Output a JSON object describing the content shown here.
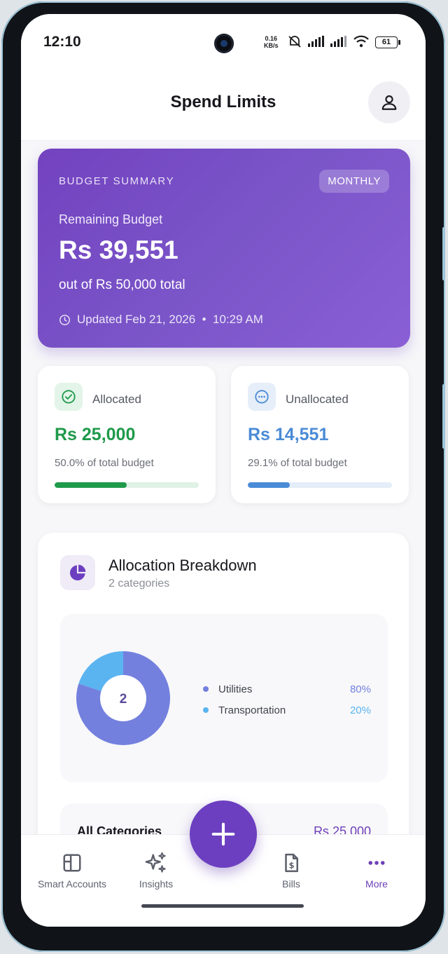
{
  "status_bar": {
    "time": "12:10",
    "network_speed": "0.16",
    "network_unit": "KB/s",
    "battery": "61"
  },
  "header": {
    "title": "Spend Limits",
    "profile_icon": "person-icon"
  },
  "budget_summary": {
    "label": "BUDGET SUMMARY",
    "period_badge": "MONTHLY",
    "remaining_label": "Remaining Budget",
    "remaining_amount": "Rs 39,551",
    "total_text": "out of Rs 50,000 total",
    "updated_text": "Updated Feb 21, 2026  •  10:29 AM",
    "gradient_start": "#7342c0",
    "gradient_end": "#8a5fd6"
  },
  "allocated": {
    "label": "Allocated",
    "amount": "Rs 25,000",
    "percent_text": "50.0% of total budget",
    "progress": 0.5,
    "color": "#1e9a4a",
    "track_color": "#e0f1e6",
    "icon": "check-circle-icon"
  },
  "unallocated": {
    "label": "Unallocated",
    "amount": "Rs 14,551",
    "percent_text": "29.1% of total budget",
    "progress": 0.291,
    "color": "#4a8bd6",
    "track_color": "#e4edf8",
    "icon": "more-circle-icon"
  },
  "breakdown": {
    "title": "Allocation Breakdown",
    "subtitle": "2 categories",
    "icon": "pie-chart-icon",
    "center_value": "2",
    "categories": [
      {
        "name": "Utilities",
        "percent": "80%",
        "value": 80,
        "color": "#7480de"
      },
      {
        "name": "Transportation",
        "percent": "20%",
        "value": 20,
        "color": "#5ab4f0"
      }
    ],
    "all_categories_label": "All Categories",
    "all_categories_total": "Rs 25,000"
  },
  "bottom_nav": {
    "items": [
      {
        "label": "Smart Accounts",
        "icon": "layout-icon"
      },
      {
        "label": "Insights",
        "icon": "sparkle-icon"
      },
      {
        "label": "Bills",
        "icon": "bill-icon"
      },
      {
        "label": "More",
        "icon": "more-dots-icon"
      }
    ],
    "fab_icon": "plus-icon",
    "accent": "#6c3fc0"
  }
}
